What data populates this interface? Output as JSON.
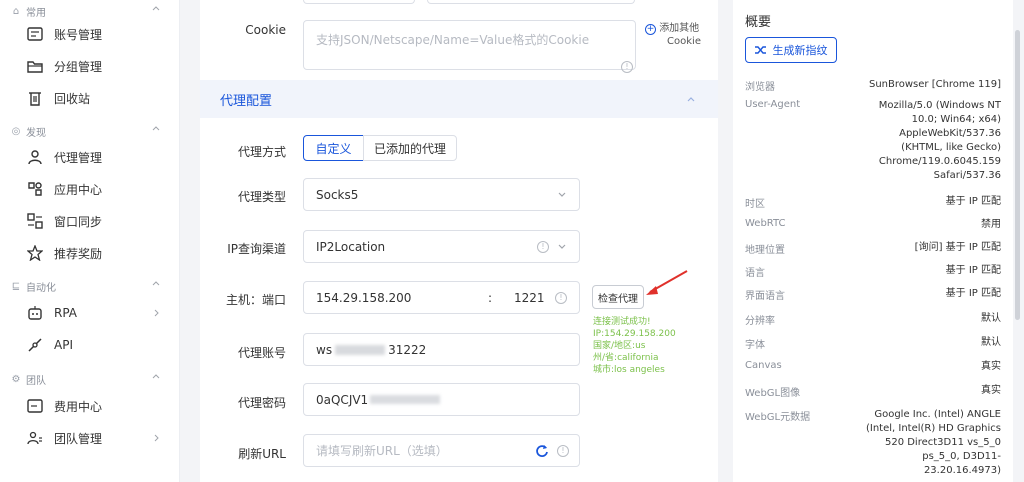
{
  "sidebar": {
    "groups": [
      {
        "label": "常用"
      },
      {
        "label": "发现"
      },
      {
        "label": "自动化"
      },
      {
        "label": "团队"
      }
    ],
    "items": [
      {
        "label": "账号管理"
      },
      {
        "label": "分组管理"
      },
      {
        "label": "回收站"
      },
      {
        "label": "代理管理"
      },
      {
        "label": "应用中心"
      },
      {
        "label": "窗口同步"
      },
      {
        "label": "推荐奖励"
      },
      {
        "label": "RPA"
      },
      {
        "label": "API"
      },
      {
        "label": "费用中心"
      },
      {
        "label": "团队管理"
      }
    ]
  },
  "form": {
    "cookie_label": "Cookie",
    "cookie_placeholder": "支持JSON/Netscape/Name=Value格式的Cookie",
    "add_cookie_l1": "添加其他",
    "add_cookie_l2": "Cookie",
    "section_title": "代理配置",
    "proxy_mode_label": "代理方式",
    "mode_custom": "自定义",
    "mode_added": "已添加的代理",
    "proxy_type_label": "代理类型",
    "proxy_type_value": "Socks5",
    "ip_channel_label": "IP查询渠道",
    "ip_channel_value": "IP2Location",
    "host_label": "主机：端口",
    "host_value": "154.29.158.200",
    "port_sep": ":",
    "port_value": "1221",
    "check_btn": "检查代理",
    "result_lines": [
      "连接测试成功!",
      "IP:154.29.158.200",
      "国家/地区:us",
      "州/省:california",
      "城市:los angeles"
    ],
    "account_label": "代理账号",
    "account_value_a": "ws",
    "account_value_b": "31222",
    "password_label": "代理密码",
    "password_value": "0aQCJV1",
    "refresh_label": "刷新URL",
    "refresh_placeholder": "请填写刷新URL（选填）"
  },
  "panel": {
    "title": "概要",
    "generate_btn": "生成新指纹",
    "rows": [
      {
        "k": "浏览器",
        "v": "SunBrowser [Chrome 119]"
      },
      {
        "k": "User-Agent",
        "v": "Mozilla/5.0 (Windows NT 10.0; Win64; x64) AppleWebKit/537.36 (KHTML, like Gecko) Chrome/119.0.6045.159 Safari/537.36"
      },
      {
        "k": "时区",
        "v": "基于 IP 匹配"
      },
      {
        "k": "WebRTC",
        "v": "禁用"
      },
      {
        "k": "地理位置",
        "v": "[询问] 基于 IP 匹配"
      },
      {
        "k": "语言",
        "v": "基于 IP 匹配"
      },
      {
        "k": "界面语言",
        "v": "基于 IP 匹配"
      },
      {
        "k": "分辨率",
        "v": "默认"
      },
      {
        "k": "字体",
        "v": "默认"
      },
      {
        "k": "Canvas",
        "v": "真实"
      },
      {
        "k": "WebGL图像",
        "v": "真实"
      },
      {
        "k": "WebGL元数据",
        "v": "Google Inc. (Intel) ANGLE (Intel, Intel(R) HD Graphics 520 Direct3D11 vs_5_0 ps_5_0, D3D11-23.20.16.4973)"
      }
    ]
  },
  "colors": {
    "accent": "#1a56db",
    "success": "#7cc14b",
    "arrow": "#e0312b"
  }
}
